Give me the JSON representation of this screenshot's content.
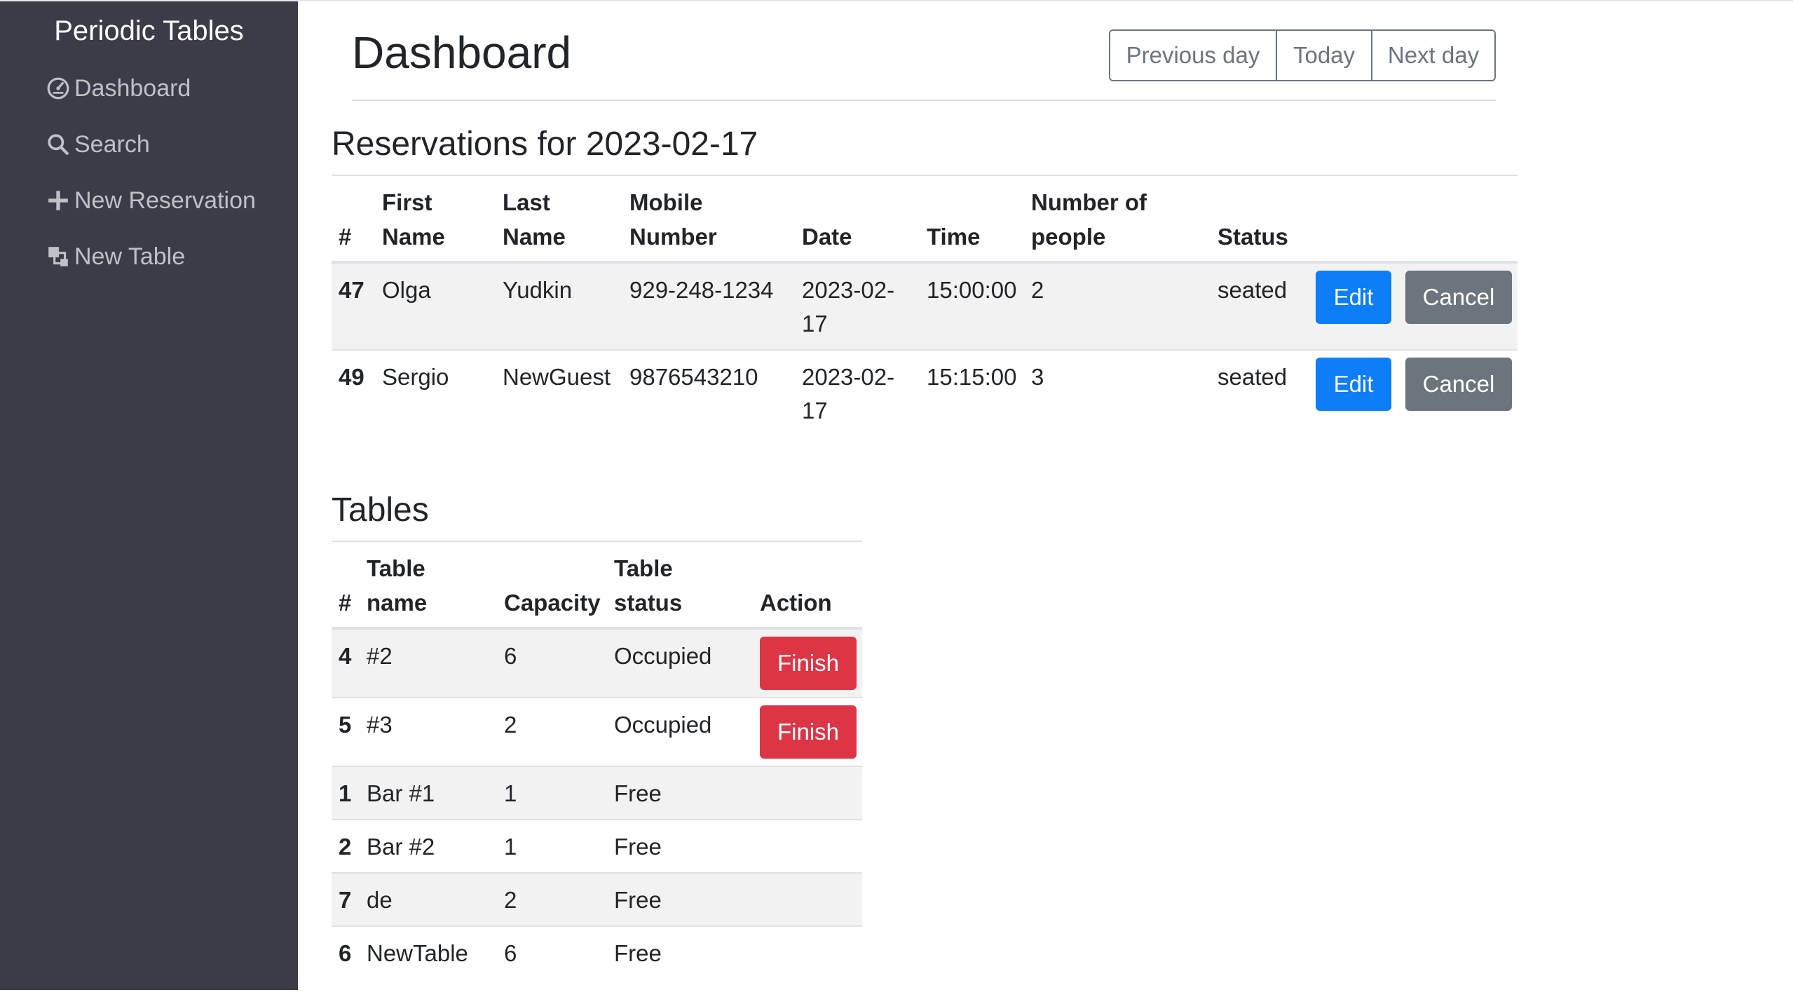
{
  "sidebar": {
    "brand": "Periodic Tables",
    "items": [
      {
        "label": "Dashboard",
        "icon": "dashboard-icon"
      },
      {
        "label": "Search",
        "icon": "search-icon"
      },
      {
        "label": "New Reservation",
        "icon": "plus-icon"
      },
      {
        "label": "New Table",
        "icon": "layers-icon"
      }
    ]
  },
  "header": {
    "title": "Dashboard",
    "nav_buttons": {
      "previous": "Previous day",
      "today": "Today",
      "next": "Next day"
    }
  },
  "reservations": {
    "title": "Reservations for 2023-02-17",
    "columns": [
      "#",
      "First Name",
      "Last Name",
      "Mobile Number",
      "Date",
      "Time",
      "Number of people",
      "Status"
    ],
    "rows": [
      {
        "id": "47",
        "first": "Olga",
        "last": "Yudkin",
        "mobile": "929-248-1234",
        "date": "2023-02-17",
        "time": "15:00:00",
        "people": "2",
        "status": "seated",
        "edit": "Edit",
        "cancel": "Cancel"
      },
      {
        "id": "49",
        "first": "Sergio",
        "last": "NewGuest",
        "mobile": "9876543210",
        "date": "2023-02-17",
        "time": "15:15:00",
        "people": "3",
        "status": "seated",
        "edit": "Edit",
        "cancel": "Cancel"
      }
    ]
  },
  "tables": {
    "title": "Tables",
    "columns": [
      "#",
      "Table name",
      "Capacity",
      "Table status",
      "Action"
    ],
    "rows": [
      {
        "id": "4",
        "name": "#2",
        "capacity": "6",
        "status": "Occupied",
        "action": "Finish"
      },
      {
        "id": "5",
        "name": "#3",
        "capacity": "2",
        "status": "Occupied",
        "action": "Finish"
      },
      {
        "id": "1",
        "name": "Bar #1",
        "capacity": "1",
        "status": "Free",
        "action": ""
      },
      {
        "id": "2",
        "name": "Bar #2",
        "capacity": "1",
        "status": "Free",
        "action": ""
      },
      {
        "id": "7",
        "name": "de",
        "capacity": "2",
        "status": "Free",
        "action": ""
      },
      {
        "id": "6",
        "name": "NewTable",
        "capacity": "6",
        "status": "Free",
        "action": ""
      }
    ]
  },
  "colors": {
    "sidebar_bg": "#3b3c48",
    "primary": "#0d7ef7",
    "secondary": "#6c757d",
    "danger": "#dc3545"
  }
}
